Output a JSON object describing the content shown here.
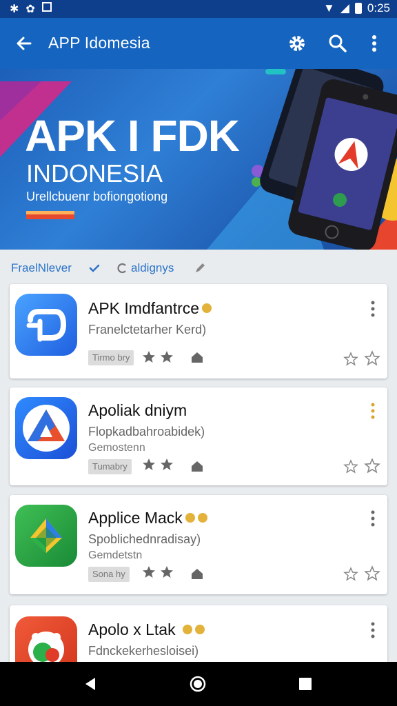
{
  "status_bar": {
    "time": "0:25"
  },
  "app_bar": {
    "title": "APP Idomesia"
  },
  "banner": {
    "headline": "APK I FDK",
    "subheadline": "INDONESIA",
    "tagline": "Urellcbuenr bofiongotiong"
  },
  "chips": {
    "first": "FraelNlever",
    "second": "aldignys"
  },
  "apps": [
    {
      "name": "APK Imdfantrce",
      "desc": "Franelctetarher Kerd)",
      "category": "",
      "tag": "Tirmo bry",
      "badges": 1
    },
    {
      "name": "Apoliak dniym",
      "desc": "Flopkadbahroabidek)",
      "category": "Gemostenn",
      "tag": "Tumabry",
      "badges": 0
    },
    {
      "name": "Applice Mack",
      "desc": "Spoblichednradisay)",
      "category": "Gemdetstn",
      "tag": "Sona hy",
      "badges": 2
    },
    {
      "name": "Apolo x Ltak",
      "desc": "Fdnckekerhesloisei)",
      "category": "",
      "tag": "",
      "badges": 2
    }
  ],
  "colors": {
    "primary": "#1565c0",
    "status_bar": "#0e3f8c",
    "accent": "#e2b23a"
  }
}
